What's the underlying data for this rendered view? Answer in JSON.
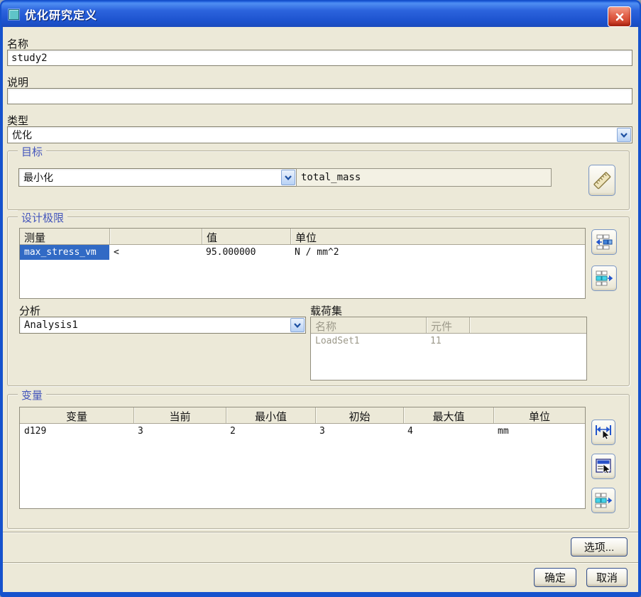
{
  "window": {
    "title": "优化研究定义"
  },
  "form": {
    "name_label": "名称",
    "name_value": "study2",
    "description_label": "说明",
    "description_value": "",
    "type_label": "类型",
    "type_value": "优化"
  },
  "goal": {
    "group_label": "目标",
    "objective_value": "最小化",
    "measure_value": "total_mass"
  },
  "design_limits": {
    "group_label": "设计极限",
    "headers": {
      "measure": "测量",
      "operator": "",
      "value": "值",
      "unit": "单位"
    },
    "rows": [
      {
        "measure": "max_stress_vm",
        "operator": "<",
        "value": "95.000000",
        "unit": "N / mm^2"
      }
    ],
    "analysis_label": "分析",
    "analysis_value": "Analysis1",
    "loadset_label": "载荷集",
    "loadset_headers": {
      "name": "名称",
      "components": "元件"
    },
    "loadset_rows": [
      {
        "name": "LoadSet1",
        "components": "11"
      }
    ]
  },
  "variables": {
    "group_label": "变量",
    "headers": {
      "variable": "变量",
      "current": "当前",
      "minimum": "最小值",
      "initial": "初始",
      "maximum": "最大值",
      "unit": "单位"
    },
    "rows": [
      {
        "variable": "d129",
        "current": "3",
        "minimum": "2",
        "initial": "3",
        "maximum": "4",
        "unit": "mm"
      }
    ]
  },
  "footer": {
    "options_label": "选项...",
    "ok_label": "确定",
    "cancel_label": "取消"
  }
}
